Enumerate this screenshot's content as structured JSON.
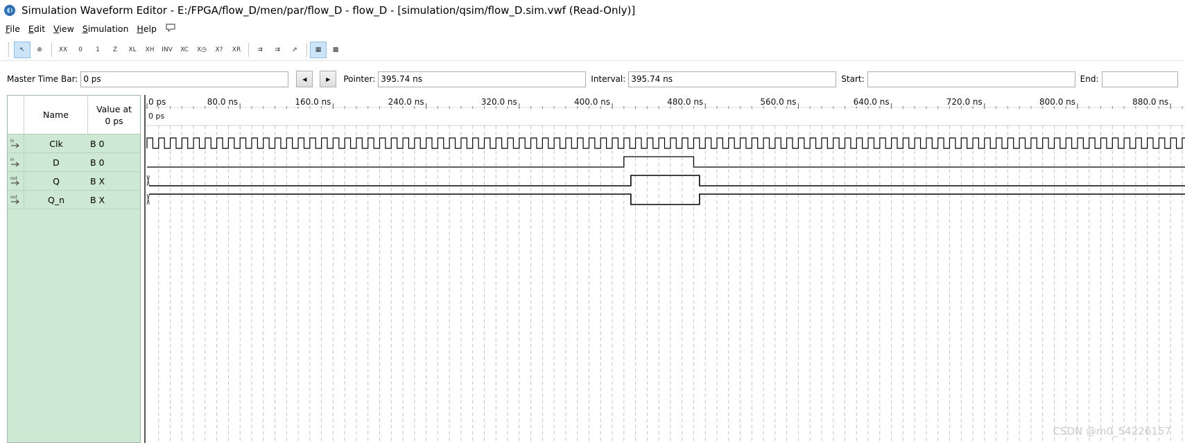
{
  "window": {
    "title": "Simulation Waveform Editor - E:/FPGA/flow_D/men/par/flow_D - flow_D - [simulation/qsim/flow_D.sim.vwf (Read-Only)]",
    "icon": "quartus-logo-icon"
  },
  "menu": [
    "File",
    "Edit",
    "View",
    "Simulation",
    "Help"
  ],
  "toolbar": {
    "buttons": [
      {
        "name": "selection-tool",
        "icon": "arrow-pointer-icon",
        "glyph": "↖",
        "active": true
      },
      {
        "name": "zoom-tool",
        "icon": "zoom-icon",
        "glyph": "⊕",
        "active": false
      },
      {
        "name": "uninitialized-x",
        "icon": "value-x-icon",
        "glyph": "XX",
        "active": false
      },
      {
        "name": "forcing-low",
        "icon": "value-0-icon",
        "glyph": "0",
        "active": false
      },
      {
        "name": "forcing-high",
        "icon": "value-1-icon",
        "glyph": "1",
        "active": false
      },
      {
        "name": "high-impedance",
        "icon": "value-z-icon",
        "glyph": "Z",
        "active": false
      },
      {
        "name": "weak-low",
        "icon": "value-l-icon",
        "glyph": "XL",
        "active": false
      },
      {
        "name": "weak-high",
        "icon": "value-h-icon",
        "glyph": "XH",
        "active": false
      },
      {
        "name": "invert",
        "icon": "invert-icon",
        "glyph": "INV",
        "active": false
      },
      {
        "name": "count-value",
        "icon": "count-value-icon",
        "glyph": "XC",
        "active": false
      },
      {
        "name": "overwrite-clock",
        "icon": "clock-icon",
        "glyph": "X◷",
        "active": false
      },
      {
        "name": "random-value",
        "icon": "random-value-icon",
        "glyph": "X?",
        "active": false
      },
      {
        "name": "arbitrary-value",
        "icon": "arbitrary-value-icon",
        "glyph": "XR",
        "active": false
      },
      {
        "name": "run-functional",
        "icon": "run-functional-icon",
        "glyph": "⇉",
        "active": false
      },
      {
        "name": "run-timing",
        "icon": "run-timing-icon",
        "glyph": "⇉",
        "active": false
      },
      {
        "name": "generate-netlist",
        "icon": "netlist-icon",
        "glyph": "⇗",
        "active": false
      },
      {
        "name": "snap-to-grid",
        "icon": "snap-grid-icon",
        "glyph": "▦",
        "active": true
      },
      {
        "name": "grid-settings",
        "icon": "grid-icon",
        "glyph": "▩",
        "active": false
      }
    ]
  },
  "timebar": {
    "master_label": "Master Time Bar:",
    "master_value": "0 ps",
    "pointer_label": "Pointer:",
    "pointer_value": "395.74 ns",
    "interval_label": "Interval:",
    "interval_value": "395.74 ns",
    "start_label": "Start:",
    "start_value": "",
    "end_label": "End:",
    "end_value": ""
  },
  "signal_table": {
    "name_header": "Name",
    "value_header_line1": "Value at",
    "value_header_line2": "0 ps",
    "signals": [
      {
        "direction": "in",
        "name": "Clk",
        "value": "B 0"
      },
      {
        "direction": "in",
        "name": "D",
        "value": "B 0"
      },
      {
        "direction": "out",
        "name": "Q",
        "value": "B X"
      },
      {
        "direction": "out",
        "name": "Q_n",
        "value": "B X"
      }
    ]
  },
  "waveform": {
    "cursor_label": "0 ps",
    "time_labels": [
      "0 ps",
      "80.0 ns",
      "160.0 ns",
      "240.0 ns",
      "320.0 ns",
      "400.0 ns",
      "480.0 ns",
      "560.0 ns",
      "640.0 ns",
      "720.0 ns",
      "800.0 ns",
      "880.0 ns"
    ],
    "ns_per_major_tick": 80,
    "clock_period_ns": 10,
    "d_high_ns": [
      410,
      470
    ],
    "q_high_ns": [
      416,
      475
    ]
  },
  "watermark": "CSDN @m0_54226157"
}
